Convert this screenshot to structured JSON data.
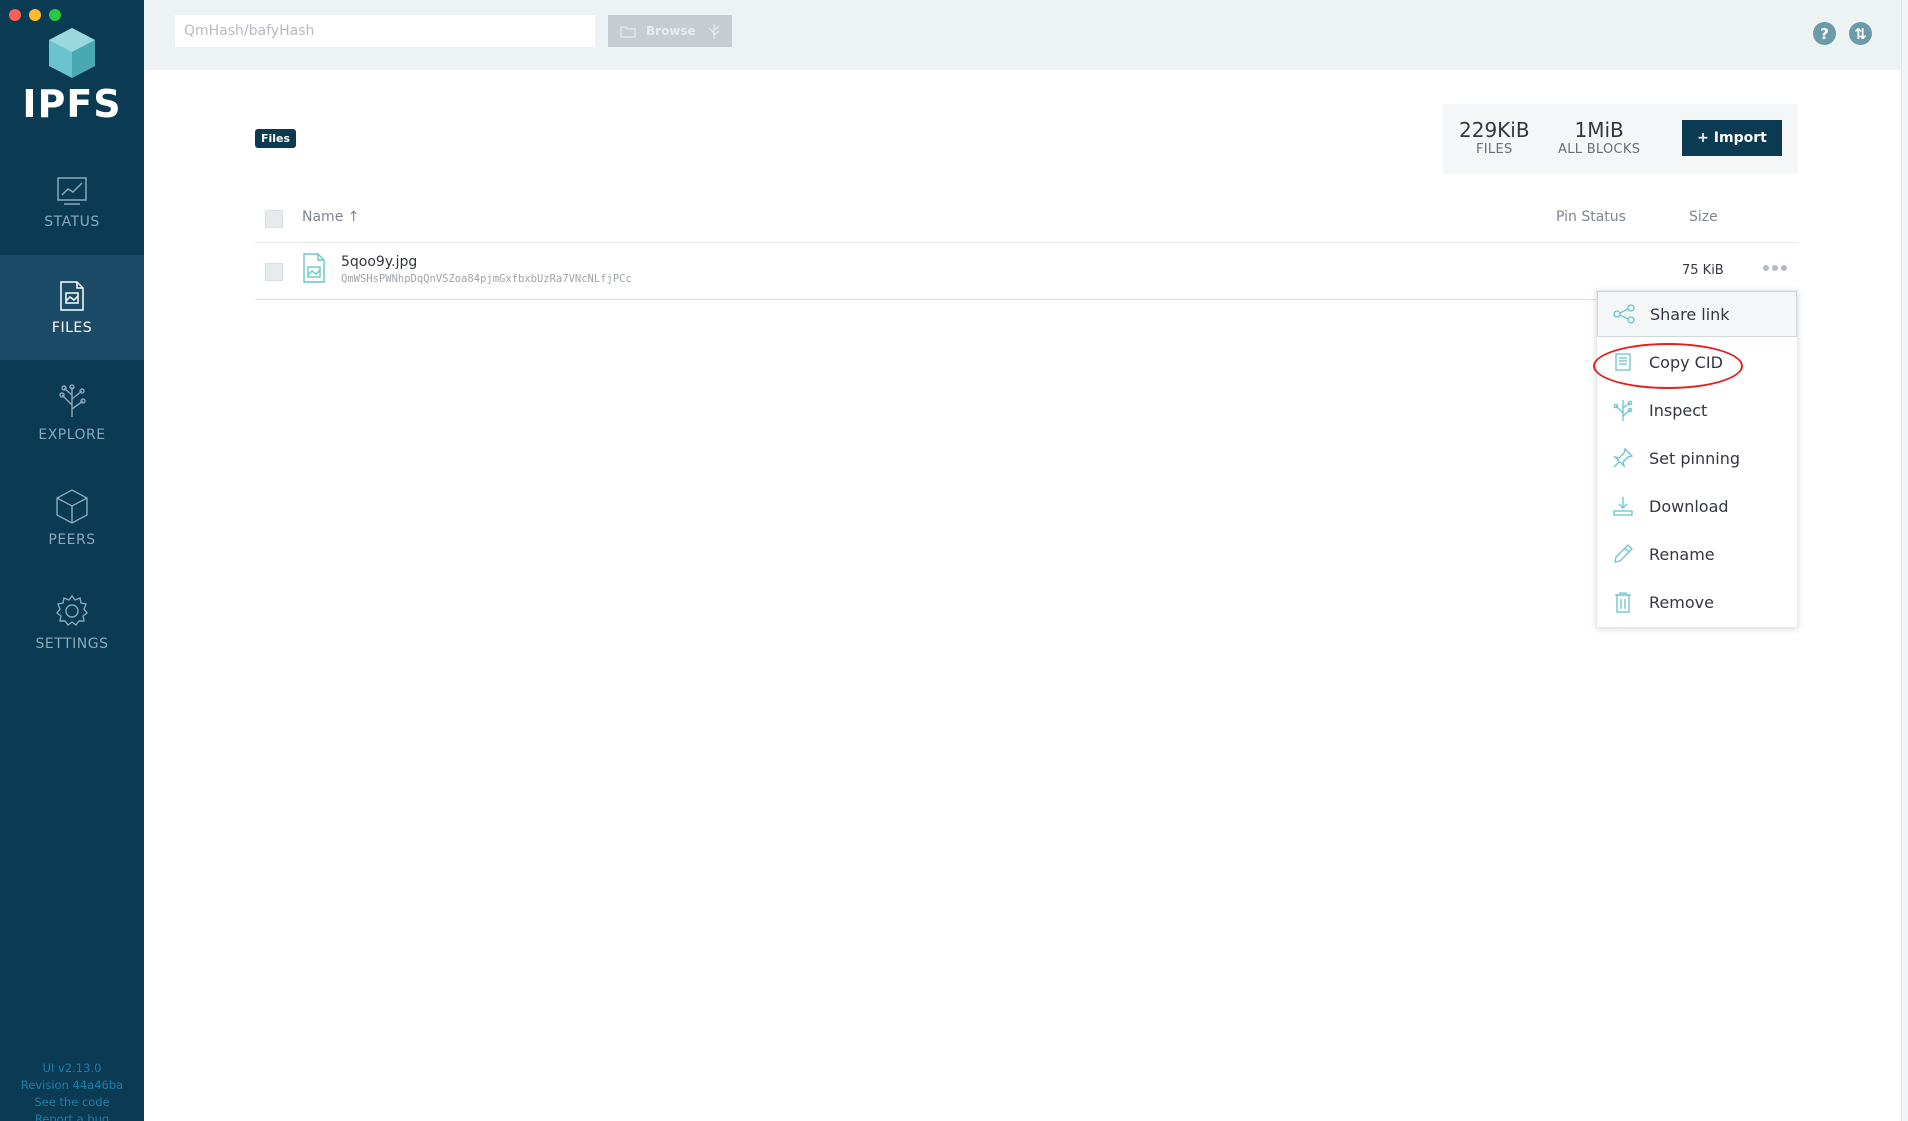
{
  "window": {
    "buttons": [
      "close",
      "minimize",
      "zoom"
    ]
  },
  "sidebar": {
    "logo_text": "IPFS",
    "items": [
      {
        "label": "STATUS",
        "icon": "status-chart-icon",
        "active": false
      },
      {
        "label": "FILES",
        "icon": "files-document-icon",
        "active": true
      },
      {
        "label": "EXPLORE",
        "icon": "explore-tree-icon",
        "active": false
      },
      {
        "label": "PEERS",
        "icon": "peers-cube-icon",
        "active": false
      },
      {
        "label": "SETTINGS",
        "icon": "settings-gear-icon",
        "active": false
      }
    ],
    "footer": {
      "version": "UI v2.13.0",
      "revision": "Revision 44a46ba",
      "code_link": "See the code",
      "bug_link": "Report a bug"
    }
  },
  "topbar": {
    "search_placeholder": "QmHash/bafyHash",
    "browse_label": "Browse",
    "icons": [
      "help-icon",
      "sync-icon"
    ]
  },
  "breadcrumb": {
    "label": "Files"
  },
  "stats": {
    "files_value": "229KiB",
    "files_label": "FILES",
    "blocks_value": "1MiB",
    "blocks_label": "ALL BLOCKS",
    "import_label": "+ Import"
  },
  "table": {
    "columns": {
      "name": "Name ↑",
      "pin_status": "Pin Status",
      "size": "Size"
    },
    "rows": [
      {
        "name": "5qoo9y.jpg",
        "cid": "QmWSHsPWNhpDqQnVSZoa84pjmGxfbxbUzRa7VNcNLfjPCc",
        "pin_status": "",
        "size": "75 KiB",
        "icon": "image-file-icon"
      }
    ]
  },
  "context_menu": {
    "items": [
      {
        "label": "Share link",
        "icon": "share-icon"
      },
      {
        "label": "Copy CID",
        "icon": "copy-icon"
      },
      {
        "label": "Inspect",
        "icon": "inspect-icon"
      },
      {
        "label": "Set pinning",
        "icon": "pin-icon"
      },
      {
        "label": "Download",
        "icon": "download-icon"
      },
      {
        "label": "Rename",
        "icon": "pencil-icon"
      },
      {
        "label": "Remove",
        "icon": "trash-icon"
      }
    ],
    "highlighted": "Copy CID"
  },
  "colors": {
    "sidebar_bg": "#0b3a53",
    "sidebar_active": "#1b4b66",
    "accent_teal": "#69c4cd",
    "topbar_bg": "#edf2f5",
    "annotation_red": "#e2201e"
  }
}
